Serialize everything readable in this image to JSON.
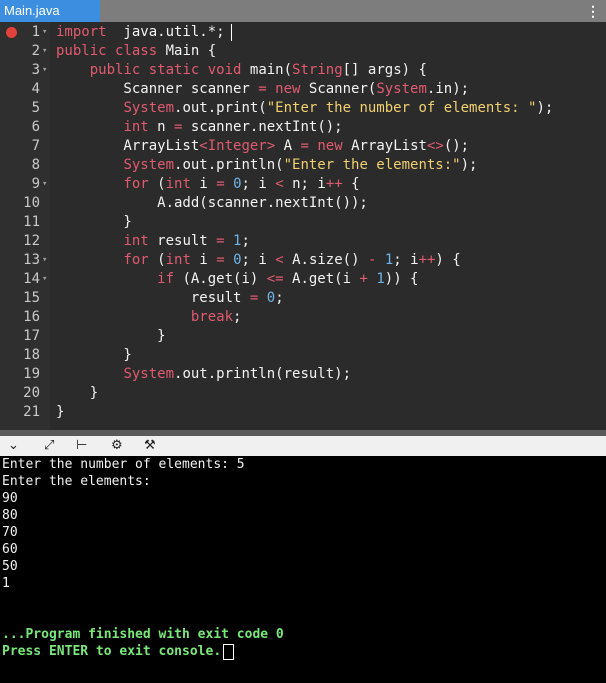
{
  "tab": {
    "title": "Main.java",
    "menu": "⋮"
  },
  "editor": {
    "lines": [
      {
        "n": "1",
        "fold": "▾",
        "segs": [
          [
            "kw",
            "import"
          ],
          [
            "",
            "  java.util.*;"
          ]
        ]
      },
      {
        "n": "2",
        "fold": "▾",
        "segs": [
          [
            "kw",
            "public"
          ],
          [
            "",
            " "
          ],
          [
            "kw",
            "class"
          ],
          [
            "",
            " Main {"
          ]
        ]
      },
      {
        "n": "3",
        "fold": "▾",
        "segs": [
          [
            "",
            "    "
          ],
          [
            "kw",
            "public"
          ],
          [
            "",
            " "
          ],
          [
            "kw",
            "static"
          ],
          [
            "",
            " "
          ],
          [
            "kw",
            "void"
          ],
          [
            "",
            " main("
          ],
          [
            "ty",
            "String"
          ],
          [
            "",
            "[] args) {"
          ]
        ]
      },
      {
        "n": "4",
        "fold": "",
        "segs": [
          [
            "",
            "        Scanner scanner "
          ],
          [
            "op",
            "="
          ],
          [
            "",
            " "
          ],
          [
            "kw",
            "new"
          ],
          [
            "",
            " Scanner("
          ],
          [
            "ty",
            "System"
          ],
          [
            "",
            ".in);"
          ]
        ]
      },
      {
        "n": "5",
        "fold": "",
        "segs": [
          [
            "",
            "        "
          ],
          [
            "ty",
            "System"
          ],
          [
            "",
            ".out.print("
          ],
          [
            "str",
            "\"Enter the number of elements: \""
          ],
          [
            "",
            ");"
          ]
        ]
      },
      {
        "n": "6",
        "fold": "",
        "segs": [
          [
            "",
            "        "
          ],
          [
            "kw",
            "int"
          ],
          [
            "",
            " n "
          ],
          [
            "op",
            "="
          ],
          [
            "",
            " scanner.nextInt();"
          ]
        ]
      },
      {
        "n": "7",
        "fold": "",
        "segs": [
          [
            "",
            "        ArrayList"
          ],
          [
            "op",
            "<"
          ],
          [
            "ty",
            "Integer"
          ],
          [
            "op",
            ">"
          ],
          [
            "",
            " A "
          ],
          [
            "op",
            "="
          ],
          [
            "",
            " "
          ],
          [
            "kw",
            "new"
          ],
          [
            "",
            " ArrayList"
          ],
          [
            "op",
            "<>"
          ],
          [
            "",
            "();"
          ]
        ]
      },
      {
        "n": "8",
        "fold": "",
        "segs": [
          [
            "",
            "        "
          ],
          [
            "ty",
            "System"
          ],
          [
            "",
            ".out.println("
          ],
          [
            "str",
            "\"Enter the elements:\""
          ],
          [
            "",
            ");"
          ]
        ]
      },
      {
        "n": "9",
        "fold": "▾",
        "segs": [
          [
            "",
            "        "
          ],
          [
            "kw",
            "for"
          ],
          [
            "",
            " ("
          ],
          [
            "kw",
            "int"
          ],
          [
            "",
            " i "
          ],
          [
            "op",
            "="
          ],
          [
            "",
            " "
          ],
          [
            "num",
            "0"
          ],
          [
            "",
            "; i "
          ],
          [
            "op",
            "<"
          ],
          [
            "",
            " n; i"
          ],
          [
            "op",
            "++"
          ],
          [
            "",
            " {"
          ]
        ]
      },
      {
        "n": "10",
        "fold": "",
        "segs": [
          [
            "",
            "            A.add(scanner.nextInt());"
          ]
        ]
      },
      {
        "n": "11",
        "fold": "",
        "segs": [
          [
            "",
            "        }"
          ]
        ]
      },
      {
        "n": "12",
        "fold": "",
        "segs": [
          [
            "",
            "        "
          ],
          [
            "kw",
            "int"
          ],
          [
            "",
            " result "
          ],
          [
            "op",
            "="
          ],
          [
            "",
            " "
          ],
          [
            "num",
            "1"
          ],
          [
            "",
            ";"
          ]
        ]
      },
      {
        "n": "13",
        "fold": "▾",
        "segs": [
          [
            "",
            "        "
          ],
          [
            "kw",
            "for"
          ],
          [
            "",
            " ("
          ],
          [
            "kw",
            "int"
          ],
          [
            "",
            " i "
          ],
          [
            "op",
            "="
          ],
          [
            "",
            " "
          ],
          [
            "num",
            "0"
          ],
          [
            "",
            "; i "
          ],
          [
            "op",
            "<"
          ],
          [
            "",
            " A.size() "
          ],
          [
            "op",
            "-"
          ],
          [
            "",
            " "
          ],
          [
            "num",
            "1"
          ],
          [
            "",
            "; i"
          ],
          [
            "op",
            "++"
          ],
          [
            "",
            ") {"
          ]
        ]
      },
      {
        "n": "14",
        "fold": "▾",
        "segs": [
          [
            "",
            "            "
          ],
          [
            "kw",
            "if"
          ],
          [
            "",
            " (A.get(i) "
          ],
          [
            "op",
            "<="
          ],
          [
            "",
            " A.get(i "
          ],
          [
            "op",
            "+"
          ],
          [
            "",
            " "
          ],
          [
            "num",
            "1"
          ],
          [
            "",
            "))"
          ],
          [
            "",
            " {"
          ]
        ]
      },
      {
        "n": "15",
        "fold": "",
        "segs": [
          [
            "",
            "                result "
          ],
          [
            "op",
            "="
          ],
          [
            "",
            " "
          ],
          [
            "num",
            "0"
          ],
          [
            "",
            ";"
          ]
        ]
      },
      {
        "n": "16",
        "fold": "",
        "segs": [
          [
            "",
            "                "
          ],
          [
            "kw",
            "break"
          ],
          [
            "",
            ";"
          ]
        ]
      },
      {
        "n": "17",
        "fold": "",
        "segs": [
          [
            "",
            "            }"
          ]
        ]
      },
      {
        "n": "18",
        "fold": "",
        "segs": [
          [
            "",
            "        }"
          ]
        ]
      },
      {
        "n": "19",
        "fold": "",
        "segs": [
          [
            "",
            "        "
          ],
          [
            "ty",
            "System"
          ],
          [
            "",
            ".out.println(result);"
          ]
        ]
      },
      {
        "n": "20",
        "fold": "",
        "segs": [
          [
            "",
            "    }"
          ]
        ]
      },
      {
        "n": "21",
        "fold": "",
        "segs": [
          [
            "",
            "}"
          ]
        ]
      }
    ]
  },
  "console_toolbar": {
    "icons": [
      "chevron-down-icon",
      "expand-icon",
      "stop-icon",
      "gear-icon",
      "debug-icon"
    ],
    "glyphs": [
      "⌄",
      "⤢",
      "⊢",
      "⚙",
      "⚒"
    ]
  },
  "console": {
    "lines": [
      "Enter the number of elements: 5",
      "Enter the elements:",
      "90",
      "80",
      "70",
      "60",
      "50",
      "1",
      "",
      "",
      ""
    ],
    "finished": "...Program finished with exit code 0",
    "press_enter": "Press ENTER to exit console."
  }
}
